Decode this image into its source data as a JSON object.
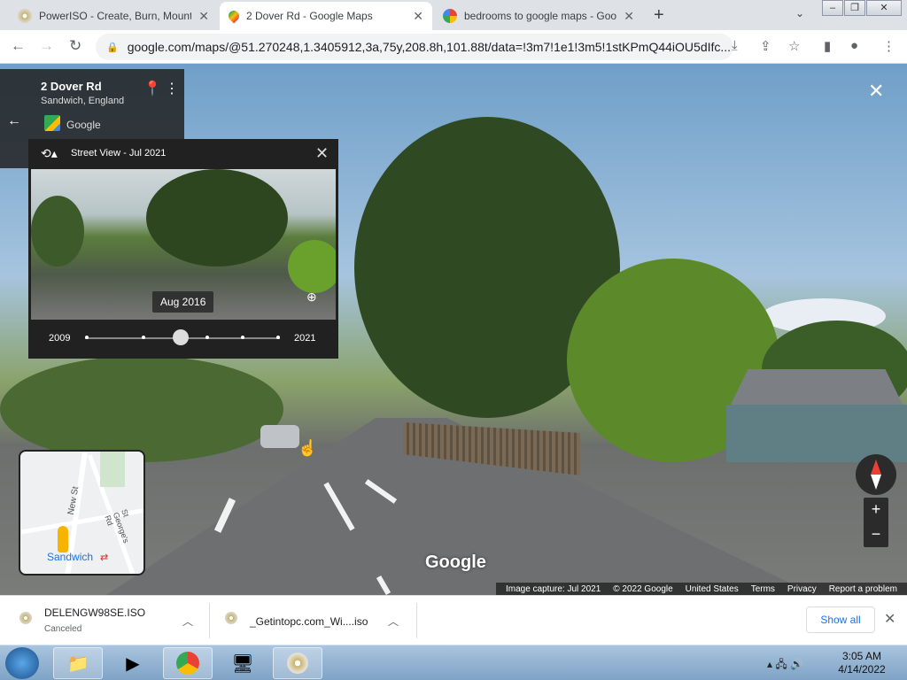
{
  "browser": {
    "tabs": [
      {
        "title": "PowerISO - Create, Burn, Mount,",
        "active": false,
        "icon": "poweriso-icon"
      },
      {
        "title": "2 Dover Rd - Google Maps",
        "active": true,
        "icon": "google-maps-icon"
      },
      {
        "title": "bedrooms to google maps - Goo",
        "active": false,
        "icon": "google-icon"
      }
    ],
    "url": "google.com/maps/@51.270248,1.3405912,3a,75y,208.8h,101.88t/data=!3m7!1e1!3m5!1stKPmQ44iOU5dIfc..."
  },
  "place": {
    "title": "2 Dover Rd",
    "subtitle": "Sandwich, England",
    "provider": "Google"
  },
  "timetravel": {
    "title": "Street View - Jul 2021",
    "selected_date": "Aug 2016",
    "start_year": "2009",
    "end_year": "2021",
    "selected_fraction": 0.49
  },
  "minimap": {
    "street1": "New St",
    "street2": "St George's Rd",
    "town": "Sandwich"
  },
  "watermark": "Google",
  "footer": {
    "capture": "Image capture: Jul 2021",
    "copyright": "© 2022 Google",
    "country": "United States",
    "terms": "Terms",
    "privacy": "Privacy",
    "report": "Report a problem"
  },
  "downloads": {
    "items": [
      {
        "name": "DELENGW98SE.ISO",
        "status": "Canceled"
      },
      {
        "name": "_Getintopc.com_Wi....iso",
        "status": ""
      }
    ],
    "show_all": "Show all"
  },
  "taskbar": {
    "time": "3:05 AM",
    "date": "4/14/2022"
  },
  "colors": {
    "accent": "#1a73e8",
    "compass_red": "#e94235"
  }
}
